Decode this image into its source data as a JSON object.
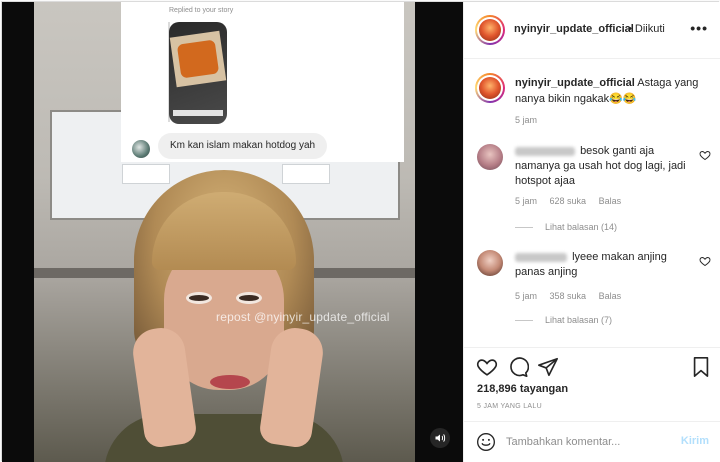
{
  "media": {
    "watermark": "repost @nyinyir_update_official",
    "dm": {
      "replied_label": "Replied to your story",
      "message": "Km kan islam makan hotdog yah"
    },
    "sound_icon": "speaker-icon"
  },
  "post": {
    "username": "nyinyir_update_official",
    "follow_status": "• Diikuti",
    "more": "•••",
    "caption": {
      "username": "nyinyir_update_official",
      "text": "Astaga yang nanya bikin ngakak😂😂",
      "time": "5 jam"
    },
    "comments": [
      {
        "text": "besok ganti aja namanya ga usah hot dog lagi, jadi hotspot ajaa",
        "time": "5 jam",
        "likes": "628 suka",
        "reply": "Balas",
        "view_replies": "Lihat balasan (14)"
      },
      {
        "text": "lyeee makan anjing panas anjing",
        "time": "5 jam",
        "likes": "358 suka",
        "reply": "Balas",
        "view_replies": "Lihat balasan (7)"
      }
    ],
    "views": "218,896 tayangan",
    "posted_ago": "5 JAM YANG LALU",
    "comment_placeholder": "Tambahkan komentar...",
    "post_label": "Kirim"
  },
  "colors": {
    "text": "#262626",
    "muted": "#8e8e8e",
    "post_button_disabled": "#b2dffc"
  }
}
